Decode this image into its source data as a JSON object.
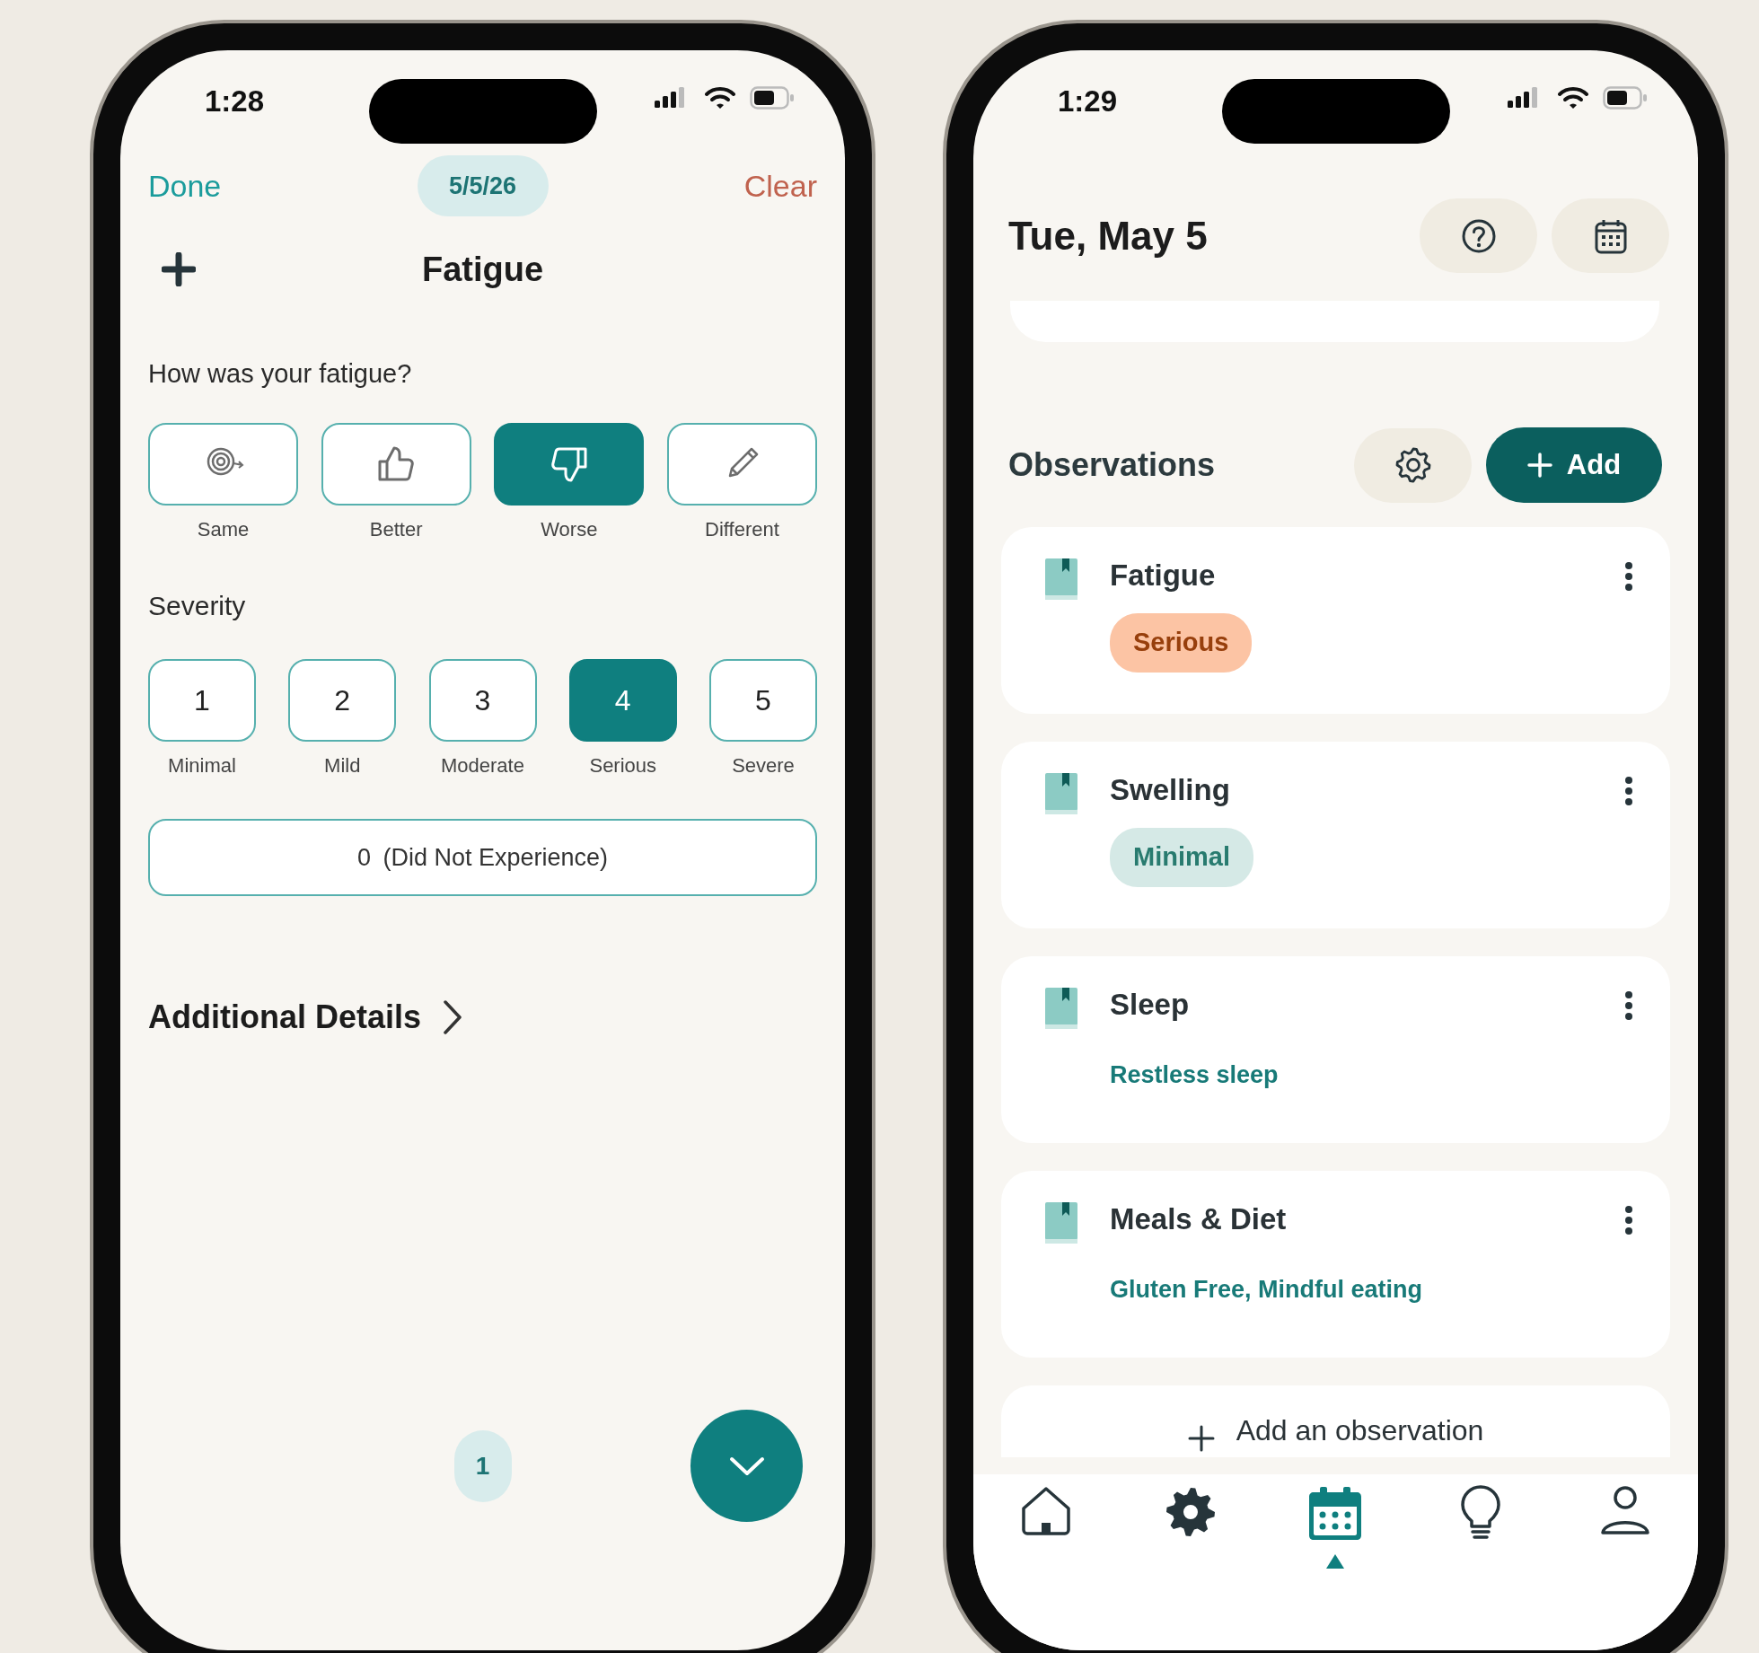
{
  "entry_screen": {
    "status_bar": {
      "time": "1:28"
    },
    "header": {
      "done": "Done",
      "date": "5/5/26",
      "clear": "Clear"
    },
    "title": "Fatigue",
    "trend": {
      "question": "How was your fatigue?",
      "options": [
        {
          "kind": "same",
          "label": "Same",
          "selected": false
        },
        {
          "kind": "better",
          "label": "Better",
          "selected": false
        },
        {
          "kind": "worse",
          "label": "Worse",
          "selected": true
        },
        {
          "kind": "different",
          "label": "Different",
          "selected": false
        }
      ]
    },
    "severity": {
      "heading": "Severity",
      "options": [
        {
          "value": "1",
          "label": "Minimal",
          "selected": false
        },
        {
          "value": "2",
          "label": "Mild",
          "selected": false
        },
        {
          "value": "3",
          "label": "Moderate",
          "selected": false
        },
        {
          "value": "4",
          "label": "Serious",
          "selected": true
        },
        {
          "value": "5",
          "label": "Severe",
          "selected": false
        }
      ],
      "none_option": {
        "value": "0",
        "label": "(Did Not Experience)",
        "selected": false
      }
    },
    "additional_details": "Additional Details",
    "page_indicator": "1"
  },
  "day_screen": {
    "status_bar": {
      "time": "1:29"
    },
    "title": "Tue, May 5",
    "observations": {
      "heading": "Observations",
      "add_button": "Add",
      "items": [
        {
          "title": "Fatigue",
          "kind": "badge",
          "value": "Serious",
          "color": "#fcc4a4"
        },
        {
          "title": "Swelling",
          "kind": "badge",
          "value": "Minimal",
          "color": "#d5e9e6"
        },
        {
          "title": "Sleep",
          "kind": "note",
          "value": "Restless sleep"
        },
        {
          "title": "Meals & Diet",
          "kind": "note",
          "value": "Gluten Free, Mindful eating"
        }
      ],
      "add_observation": "Add an observation"
    },
    "tab_bar": [
      {
        "kind": "home",
        "selected": false
      },
      {
        "kind": "settings",
        "selected": false
      },
      {
        "kind": "calendar",
        "selected": true
      },
      {
        "kind": "tips",
        "selected": false
      },
      {
        "kind": "profile",
        "selected": false
      }
    ]
  }
}
